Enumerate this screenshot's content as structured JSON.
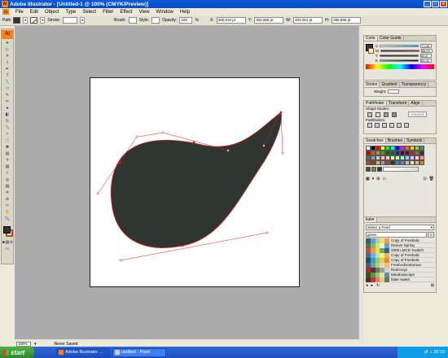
{
  "window": {
    "title": "Adobe Illustrator - [Untitled-1 @ 100% (CMYK/Preview)]",
    "app_icon": "Ai"
  },
  "menu": [
    "File",
    "Edit",
    "Object",
    "Type",
    "Select",
    "Filter",
    "Effect",
    "View",
    "Window",
    "Help"
  ],
  "control_bar": {
    "selection_label": "Path",
    "stroke_label": "Stroke:",
    "brush_label": "Brush:",
    "style_label": "Style:",
    "opacity_label": "Opacity:",
    "opacity_value": "100",
    "opacity_unit": "%",
    "x_label": "X:",
    "x_value": "300,919 pt",
    "y_label": "Y:",
    "y_value": "302,595 pt",
    "w_label": "W:",
    "w_value": "403,051 pt",
    "h_label": "H:",
    "h_value": "396,896 pt"
  },
  "toolbox": {
    "logo": "Ai"
  },
  "color_panel": {
    "tabs": [
      "Color",
      "Color Guide"
    ],
    "channels": [
      {
        "label": "C",
        "value": "72,05"
      },
      {
        "label": "M",
        "value": "56,09"
      },
      {
        "label": "Y",
        "value": "69,8"
      },
      {
        "label": "K",
        "value": "59,22"
      }
    ],
    "fill_color": "#2F3631"
  },
  "stroke_panel": {
    "tabs": [
      "Stroke",
      "Gradient",
      "Transparency"
    ],
    "weight_label": "Weight:"
  },
  "pathfinder_panel": {
    "tabs": [
      "Pathfinder",
      "Transform",
      "Align"
    ],
    "shape_modes_label": "Shape Modes:",
    "pathfinders_label": "Pathfinders:",
    "expand_label": "Expand"
  },
  "swatches_panel": {
    "tabs": [
      "Swatches",
      "Brushes",
      "Symbols"
    ]
  },
  "kuler_panel": {
    "tab": "kuler",
    "select_feed": "Select a Feed",
    "search_value": "green",
    "themes": [
      {
        "name": "Copy of Freshalic",
        "colors": [
          "#2B5C8A",
          "#5AA0D0",
          "#A8D870",
          "#E8E070",
          "#F0A040"
        ]
      },
      {
        "name": "Denver Spring",
        "colors": [
          "#4A7A3A",
          "#8AB858",
          "#D0E090",
          "#F0F0C0",
          "#70A0C0"
        ]
      },
      {
        "name": "2009 LMCD Swatch",
        "colors": [
          "#D04040",
          "#F0A030",
          "#F0E060",
          "#60B060",
          "#3060A0"
        ]
      },
      {
        "name": "Copy of Freshalic",
        "colors": [
          "#3B6C9A",
          "#6AB0E0",
          "#B8E880",
          "#F8F080",
          "#F0B050"
        ]
      },
      {
        "name": "Copy of Freshalic",
        "colors": [
          "#1B4C7A",
          "#4A90C0",
          "#98C860",
          "#D8D060",
          "#E09030"
        ]
      },
      {
        "name": "FreshAdventurous",
        "colors": [
          "#406080",
          "#70A090",
          "#B0D070",
          "#E0E0A0",
          "#F0C080"
        ]
      },
      {
        "name": "RedGreys",
        "colors": [
          "#C02020",
          "#404040",
          "#707070",
          "#A0A0A0",
          "#D0D0D0"
        ]
      },
      {
        "name": "Meadowscape",
        "colors": [
          "#2A5A2A",
          "#5A9A3A",
          "#9AC860",
          "#D8E8A0",
          "#6090B0"
        ]
      },
      {
        "name": "bitter sweet",
        "colors": [
          "#702030",
          "#B04040",
          "#E08060",
          "#F0C090",
          "#608050"
        ]
      }
    ]
  },
  "status": {
    "zoom": "100%",
    "save_state": "Never Saved"
  },
  "taskbar": {
    "start_label": "start",
    "tasks": [
      "Adobe Illustrator ...",
      "untitled - Paint"
    ],
    "clock": "20:10"
  },
  "colors": {
    "shape_fill": "#2F3631",
    "path_selection": "#D42020",
    "app_accent": "#FF7F18"
  }
}
